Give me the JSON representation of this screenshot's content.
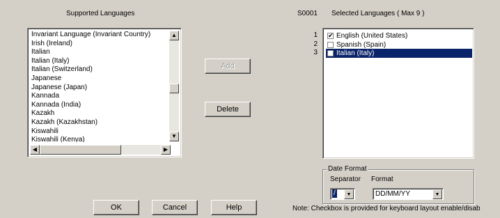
{
  "left": {
    "title": "Supported Languages",
    "languages": [
      "Invariant Language (Invariant Country)",
      "Irish (Ireland)",
      "Italian",
      "Italian (Italy)",
      "Italian (Switzerland)",
      "Japanese",
      "Japanese (Japan)",
      "Kannada",
      "Kannada (India)",
      "Kazakh",
      "Kazakh (Kazakhstan)",
      "Kiswahili",
      "Kiswahili (Kenya)"
    ]
  },
  "middle": {
    "add_label": "Add",
    "delete_label": "Delete"
  },
  "right": {
    "count": "S0001",
    "title": "Selected Languages ( Max 9 )",
    "items": [
      {
        "num": "1",
        "label": "English (United States)",
        "checked": true
      },
      {
        "num": "2",
        "label": "Spanish (Spain)",
        "checked": false
      },
      {
        "num": "3",
        "label": "Italian (Italy)",
        "checked": false
      }
    ]
  },
  "date_format": {
    "title": "Date Format",
    "separator_label": "Separator",
    "format_label": "Format",
    "separator_value": "/",
    "format_value": "DD/MM/YY"
  },
  "footer": {
    "ok_label": "OK",
    "cancel_label": "Cancel",
    "help_label": "Help",
    "note": "Note: Checkbox is provided for keyboard layout enable/disab"
  },
  "icons": {
    "up": "▲",
    "down": "▼",
    "left": "◀",
    "right": "▶",
    "check": "✔",
    "dropdown": "▼"
  }
}
